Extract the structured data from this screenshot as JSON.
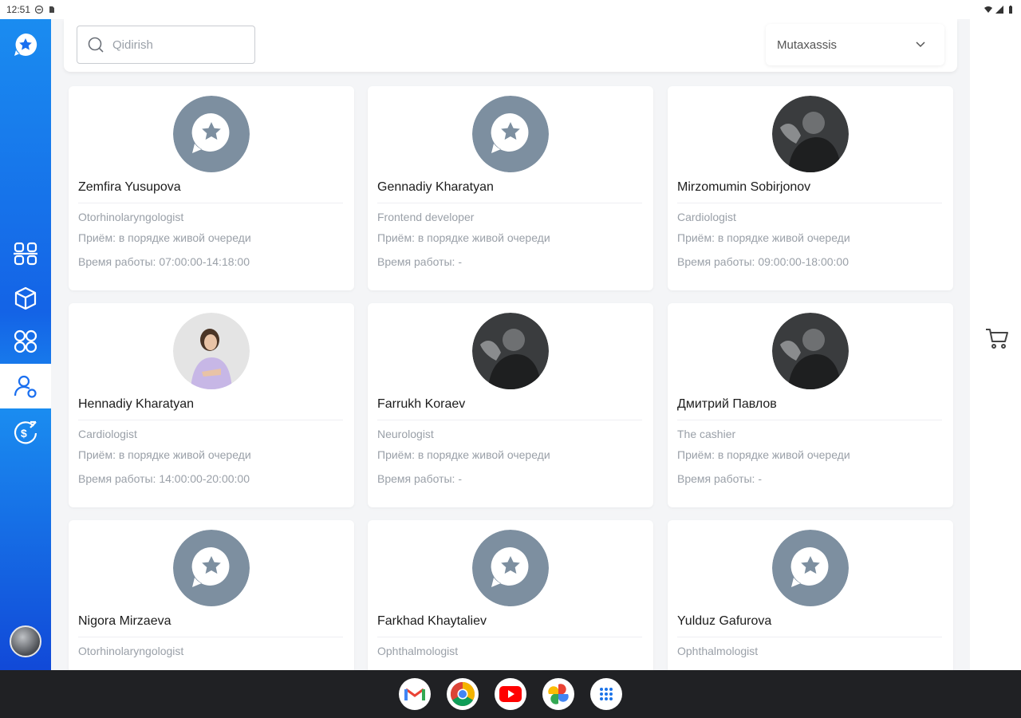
{
  "statusbar": {
    "time": "12:51"
  },
  "search": {
    "placeholder": "Qidirish"
  },
  "filter": {
    "label": "Mutaxassis"
  },
  "cards": [
    {
      "name": "Zemfira Yusupova",
      "specialty": "Otorhinolaryngologist",
      "reception": "Приём: в порядке живой очереди",
      "hours": "Время работы: 07:00:00-14:18:00",
      "avatar": "placeholder"
    },
    {
      "name": "Gennadiy Kharatyan",
      "specialty": "Frontend developer",
      "reception": "Приём: в порядке живой очереди",
      "hours": "Время работы: -",
      "avatar": "placeholder"
    },
    {
      "name": "Mirzomumin Sobirjonov",
      "specialty": "Cardiologist",
      "reception": "Приём: в порядке живой очереди",
      "hours": "Время работы: 09:00:00-18:00:00",
      "avatar": "photo-dark"
    },
    {
      "name": "Hennadiy Kharatyan",
      "specialty": "Cardiologist",
      "reception": "Приём: в порядке живой очереди",
      "hours": "Время работы: 14:00:00-20:00:00",
      "avatar": "photo-light"
    },
    {
      "name": "Farrukh Koraev",
      "specialty": "Neurologist",
      "reception": "Приём: в порядке живой очереди",
      "hours": "Время работы: -",
      "avatar": "photo-dark"
    },
    {
      "name": "Дмитрий Павлов",
      "specialty": "The cashier",
      "reception": "Приём: в порядке живой очереди",
      "hours": "Время работы: -",
      "avatar": "photo-dark"
    },
    {
      "name": "Nigora Mirzaeva",
      "specialty": "Otorhinolaryngologist",
      "reception": "",
      "hours": "",
      "avatar": "placeholder"
    },
    {
      "name": "Farkhad Khaytaliev",
      "specialty": "Ophthalmologist",
      "reception": "",
      "hours": "",
      "avatar": "placeholder"
    },
    {
      "name": "Yulduz Gafurova",
      "specialty": "Ophthalmologist",
      "reception": "",
      "hours": "",
      "avatar": "placeholder"
    }
  ],
  "colors": {
    "accent": "#1a6ff0",
    "placeholder_avatar": "#7d8fa0",
    "muted_text": "#9aa0a8"
  },
  "icons": {
    "sidebar": [
      "logo-icon",
      "qr-scan-icon",
      "package-icon",
      "apps-icon",
      "users-icon",
      "cashback-icon"
    ],
    "dock": [
      "gmail-icon",
      "chrome-icon",
      "youtube-icon",
      "photos-icon",
      "app-drawer-icon"
    ],
    "floating": "cart-icon"
  }
}
